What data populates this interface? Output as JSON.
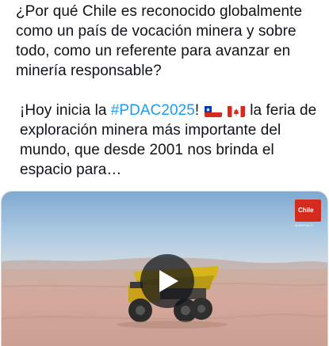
{
  "tweet": {
    "paragraph1": "¿Por qué Chile es reconocido globalmente como un país de vocación minera y sobre todo, como un referente para avanzar en minería responsable?",
    "p2_prefix": "¡Hoy inicia la ",
    "hashtag": "#PDAC2025",
    "p2_exclaim": "!",
    "p2_rest": " la feria de exploración minera más importante del mundo, que desde 2001 nos brinda el espacio para…",
    "flags": [
      "chile-flag-icon",
      "canada-flag-icon"
    ]
  },
  "media": {
    "type": "video",
    "logo_text": "Chile",
    "logo_tagline": "MINERALS",
    "play_icon": "play-icon"
  },
  "colors": {
    "text": "#0f1419",
    "hashtag": "#1d9bf0",
    "border": "#cfd9de",
    "brand_red": "#d52b1e"
  }
}
